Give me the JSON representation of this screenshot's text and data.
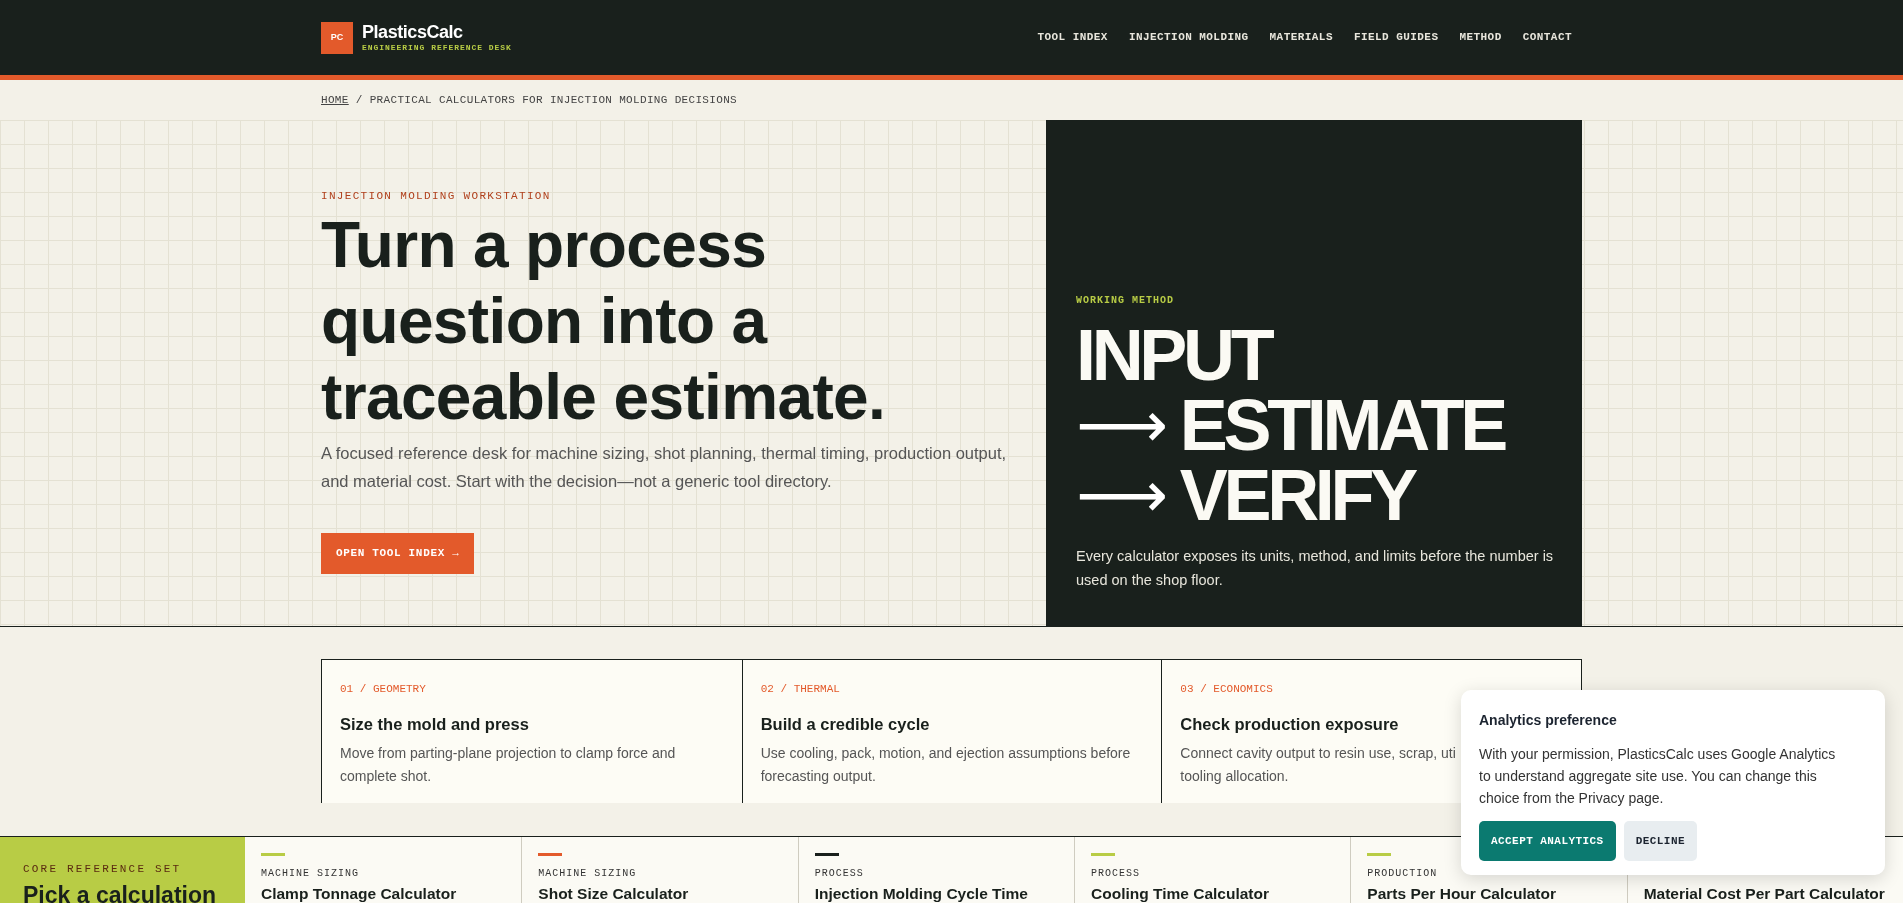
{
  "header": {
    "logo_mark": "PC",
    "brand": "PlasticsCalc",
    "tagline": "ENGINEERING REFERENCE DESK",
    "nav": [
      "TOOL INDEX",
      "INJECTION MOLDING",
      "MATERIALS",
      "FIELD GUIDES",
      "METHOD",
      "CONTACT"
    ]
  },
  "breadcrumb": {
    "home": "HOME",
    "separator": "/",
    "current": "PRACTICAL CALCULATORS FOR INJECTION MOLDING DECISIONS"
  },
  "hero": {
    "eyebrow": "INJECTION MOLDING WORKSTATION",
    "headline": "Turn a process question into a traceable estimate.",
    "lead": "A focused reference desk for machine sizing, shot planning, thermal timing, production output, and material cost. Start with the decision—not a generic tool directory.",
    "button": "OPEN TOOL INDEX →"
  },
  "method_panel": {
    "eyebrow": "WORKING METHOD",
    "steps": [
      {
        "label": "INPUT"
      },
      {
        "arrow": "⟶",
        "label": "ESTIMATE"
      },
      {
        "arrow": "⟶",
        "label": "VERIFY"
      }
    ],
    "note": "Every calculator exposes its units, method, and limits before the number is used on the shop floor."
  },
  "decision_cards": [
    {
      "kicker": "01 / GEOMETRY",
      "title": "Size the mold and press",
      "lines": [
        "Move from parting-plane projection to clamp force and",
        "complete shot."
      ]
    },
    {
      "kicker": "02 / THERMAL",
      "title": "Build a credible cycle",
      "lines": [
        "Use cooling, pack, motion, and ejection assumptions before",
        "forecasting output."
      ]
    },
    {
      "kicker": "03 / ECONOMICS",
      "title": "Check production exposure",
      "lines": [
        "Connect cavity output to resin use, scrap, uti",
        "tooling allocation."
      ]
    }
  ],
  "reference_set": {
    "eyebrow": "CORE REFERENCE SET",
    "title": "Pick a calculation",
    "calculators": [
      {
        "category": "MACHINE SIZING",
        "color": "#b8cc45",
        "title": "Clamp Tonnage Calculator"
      },
      {
        "category": "MACHINE SIZING",
        "color": "#e35a2b",
        "title": "Shot Size Calculator"
      },
      {
        "category": "PROCESS",
        "color": "#19201c",
        "title": "Injection Molding Cycle Time"
      },
      {
        "category": "PROCESS",
        "color": "#b8cc45",
        "title": "Cooling Time Calculator"
      },
      {
        "category": "PRODUCTION",
        "color": "#b8cc45",
        "title": "Parts Per Hour Calculator"
      },
      {
        "title": "Material Cost Per Part Calculator"
      }
    ]
  },
  "cookie_banner": {
    "title": "Analytics preference",
    "body": "With your permission, PlasticsCalc uses Google Analytics to understand aggregate site use. You can change this choice from the Privacy page.",
    "accept": "ACCEPT ANALYTICS",
    "decline": "DECLINE"
  }
}
